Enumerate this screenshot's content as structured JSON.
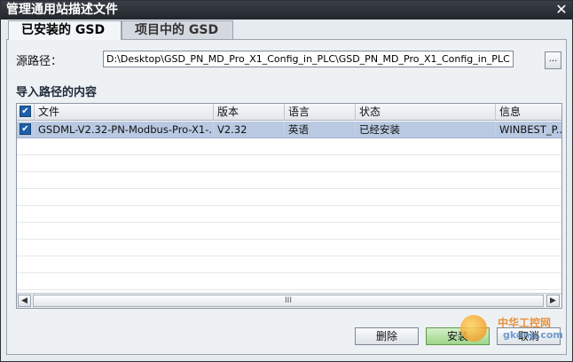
{
  "window": {
    "title": "管理通用站描述文件"
  },
  "tabs": [
    {
      "label": "已安装的 GSD"
    },
    {
      "label": "项目中的 GSD"
    }
  ],
  "source": {
    "label": "源路径：",
    "value": "D:\\Desktop\\GSD_PN_MD_Pro_X1_Config_in_PLC\\GSD_PN_MD_Pro_X1_Config_in_PLC",
    "browse_label": "..."
  },
  "section": {
    "title": "导入路径的内容"
  },
  "table": {
    "columns": [
      "文件",
      "版本",
      "语言",
      "状态",
      "信息"
    ],
    "rows": [
      {
        "file": "GSDML-V2.32-PN-Modbus-Pro-X1-...",
        "version": "V2.32",
        "language": "英语",
        "status": "已经安装",
        "info": "WINBEST_P..."
      }
    ],
    "scroll_thumb_glyph": "III"
  },
  "buttons": {
    "delete": "删除",
    "install": "安装",
    "cancel": "取消"
  },
  "watermark": {
    "line1": "中华工控网",
    "line2": "gkong.com"
  },
  "colors": {
    "titlebar": "#2b2f36",
    "selection": "#b9c9e2",
    "checkbox": "#1e5fa8",
    "install_button": "#9ed58a"
  }
}
